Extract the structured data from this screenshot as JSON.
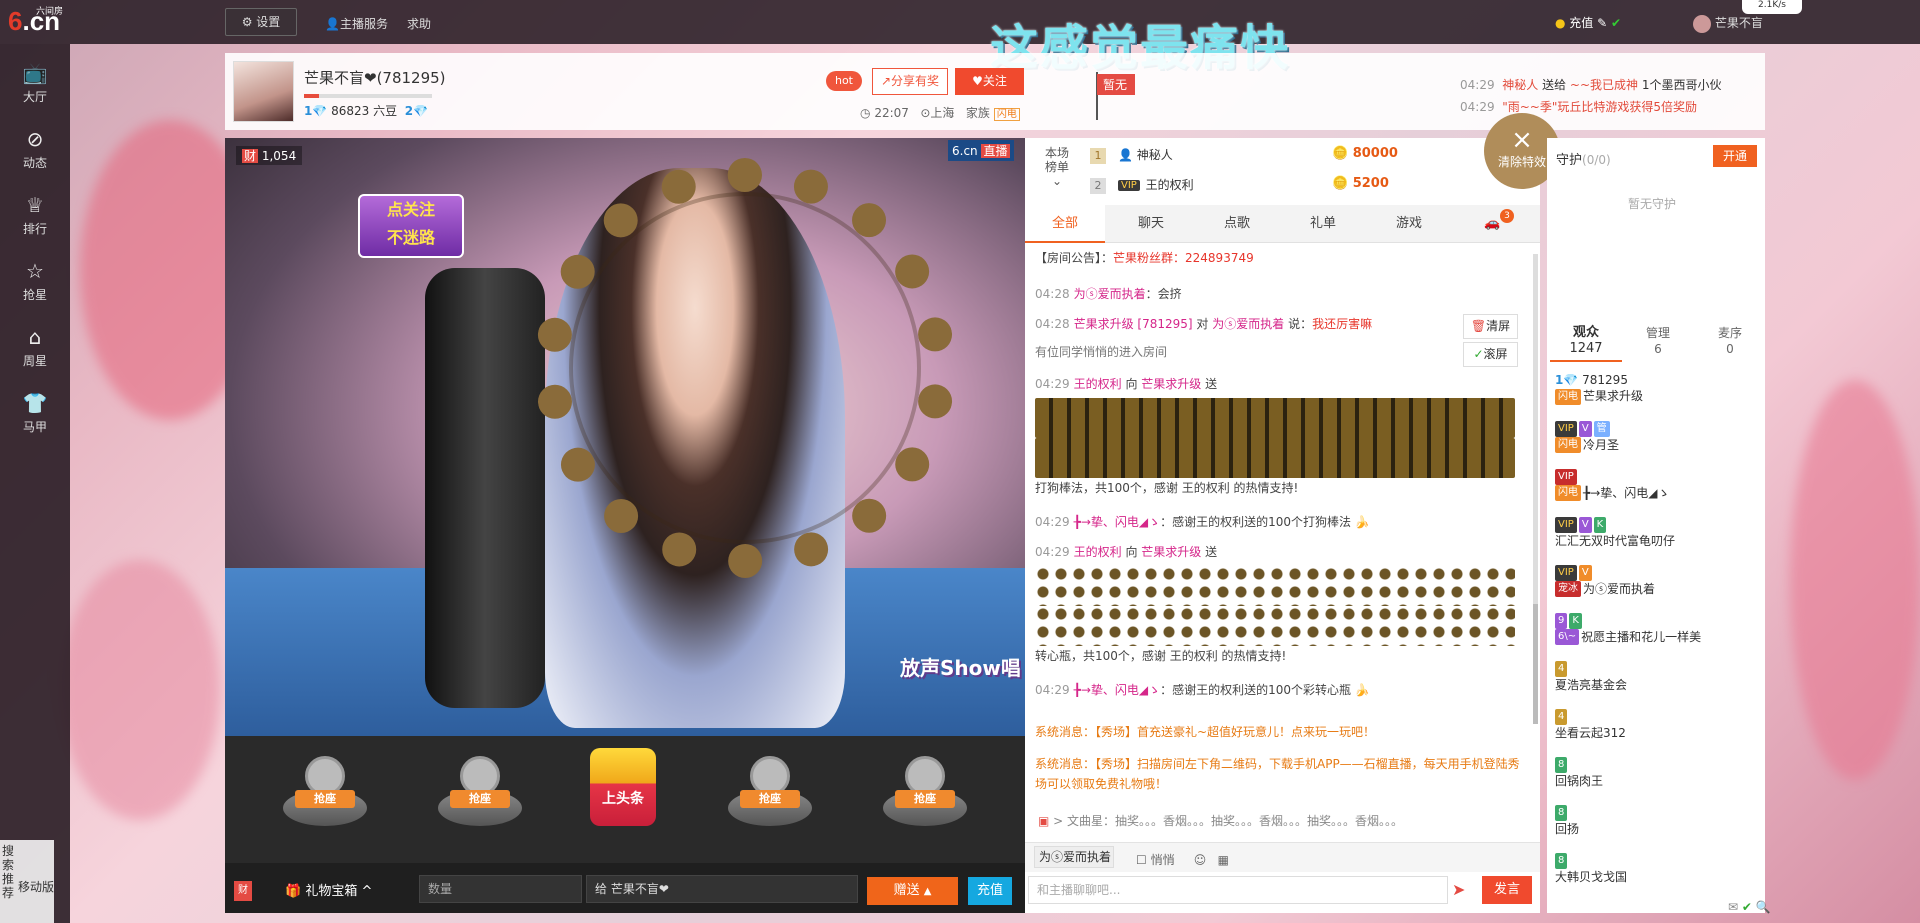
{
  "logo": {
    "six": "6",
    "cn": ".cn",
    "small": "六间房"
  },
  "topbar": {
    "settings": "设置",
    "host_service": "主播服务",
    "help": "求助",
    "banner": "这感觉最痛快",
    "recharge": "充值",
    "user": "芒果不盲",
    "net_speed": "2.1K/s"
  },
  "sidebar": {
    "items": [
      {
        "icon": "tv-icon",
        "label": "大厅"
      },
      {
        "icon": "compass-icon",
        "label": "动态"
      },
      {
        "icon": "crown-icon",
        "label": "排行"
      },
      {
        "icon": "star-icon",
        "label": "抢星"
      },
      {
        "icon": "gift-basket-icon",
        "label": "周星"
      },
      {
        "icon": "shirt-icon",
        "label": "马甲"
      }
    ]
  },
  "anchor": {
    "name": "芒果不盲❤(781295)",
    "level": "1",
    "beans": "86823 六豆",
    "next_level": "2",
    "time": "22:07",
    "location": "上海",
    "family_label": "家族",
    "family_tag": "闪电",
    "hot": "hot",
    "share": "分享有奖",
    "follow": "关注",
    "flag": "暂无"
  },
  "top_messages": [
    {
      "time": "04:29",
      "from": "神秘人",
      "verb": "送给",
      "to": "~~我已成神",
      "rest": "1个墨西哥小伙"
    },
    {
      "time": "04:29",
      "from": "\"雨~~季\"玩丘比特游戏获得5倍奖励",
      "verb": "",
      "to": "",
      "rest": ""
    }
  ],
  "video": {
    "viewers": "1,054",
    "brand": "6.cn",
    "live": "直播",
    "sticker_top": "点关注",
    "sticker_bottom": "不迷路",
    "fang": "放声Show唱"
  },
  "seats": [
    "抢座",
    "抢座",
    "上头条",
    "抢座",
    "抢座"
  ],
  "giftbar": {
    "cai": "财",
    "gift_box": "礼物宝箱",
    "qty_placeholder": "数量",
    "to_label": "给",
    "to_value": "芒果不盲❤",
    "send": "赠送",
    "charge": "充值"
  },
  "rank": {
    "title": "本场榜单",
    "rows": [
      {
        "num": "1",
        "name": "神秘人",
        "score": "80000"
      },
      {
        "num": "2",
        "name": "王的权利",
        "score": "5200"
      }
    ]
  },
  "clear_effects": "清除特效",
  "tabs": [
    "全部",
    "聊天",
    "点歌",
    "礼单",
    "游戏"
  ],
  "car_badge": "3",
  "chat": {
    "announcement_label": "【房间公告】：",
    "announcement": "芒果粉丝群：224893749",
    "lines": [
      {
        "time": "04:28",
        "user": "为ⓢ爱而执着",
        "text": "：会挤"
      },
      {
        "time": "04:28",
        "user": "芒果求升级 [781295]",
        "mid": "对",
        "to": "为ⓢ爱而执着",
        "say": "说：",
        "text": "我还厉害嘛"
      },
      {
        "time": "",
        "user": "",
        "text": "有位同学悄悄的进入房间"
      },
      {
        "time": "04:29",
        "user": "王的权利",
        "mid": "向",
        "to": "芒果求升级",
        "say": "送",
        "text": "打狗棒法，共100个，感谢 王的权利 的热情支持!"
      },
      {
        "time": "04:29",
        "user": "╊→挚、闪电◢ゝ",
        "text": "：感谢王的权利送的100个打狗棒法"
      },
      {
        "time": "04:29",
        "user": "王的权利",
        "mid": "向",
        "to": "芒果求升级",
        "say": "送",
        "text": "转心瓶，共100个，感谢 王的权利 的热情支持!"
      },
      {
        "time": "04:29",
        "user": "╊→挚、闪电◢ゝ",
        "text": "：感谢王的权利送的100个彩转心瓶"
      }
    ],
    "system1": "系统消息：【秀场】首充送豪礼~超值好玩意儿！点来玩一玩吧！",
    "system2": "系统消息：【秀场】扫描房间左下角二维码，下载手机APP——石榴直播，每天用手机登陆秀场可以领取免费礼物哦！",
    "song_line": "文曲星：抽奖。。。香烟。。。抽奖。。。香烟。。。抽奖。。。香烟。。。",
    "clear": "清屏",
    "scroll": "滚屏",
    "whisper_to": "为ⓢ爱而执着",
    "whisper": "悄悄",
    "input_placeholder": "和主播聊聊吧...",
    "send": "发言"
  },
  "guard": {
    "title": "守护",
    "count": "(0/0)",
    "open": "开通",
    "empty": "暂无守护"
  },
  "audience": {
    "tabs": [
      {
        "label": "观众",
        "count": "1247"
      },
      {
        "label": "管理",
        "count": "6"
      },
      {
        "label": "麦序",
        "count": "0"
      }
    ],
    "items": [
      {
        "badges": [
          "1"
        ],
        "id": "781295",
        "name": "芒果求升级",
        "tag": "闪电"
      },
      {
        "badges": [
          "V",
          "管"
        ],
        "name": "冷月圣",
        "tag": "闪电"
      },
      {
        "badges": [
          ""
        ],
        "name": "╊→挚、闪电◢ゝ",
        "tag": "闪电"
      },
      {
        "badges": [
          "V",
          "K"
        ],
        "name": "汇汇无双时代富龟叨仔"
      },
      {
        "badges": [
          "V"
        ],
        "name": "为ⓢ爱而执着",
        "tag": "宠冰"
      },
      {
        "badges": [
          "K"
        ],
        "name": "祝愿主播和花儿一样美",
        "tag": "6\\~"
      },
      {
        "badges": [
          "4"
        ],
        "name": "夏浩亮基金会"
      },
      {
        "badges": [
          "4"
        ],
        "name": "坐看云起312"
      },
      {
        "badges": [
          "8"
        ],
        "name": "回锅肉王"
      },
      {
        "badges": [
          "8"
        ],
        "name": "回扬"
      },
      {
        "badges": [
          "8"
        ],
        "name": "大韩贝戈戈国"
      }
    ]
  },
  "left_bottom": {
    "search": "搜索推荐",
    "mobile": "移动版"
  }
}
